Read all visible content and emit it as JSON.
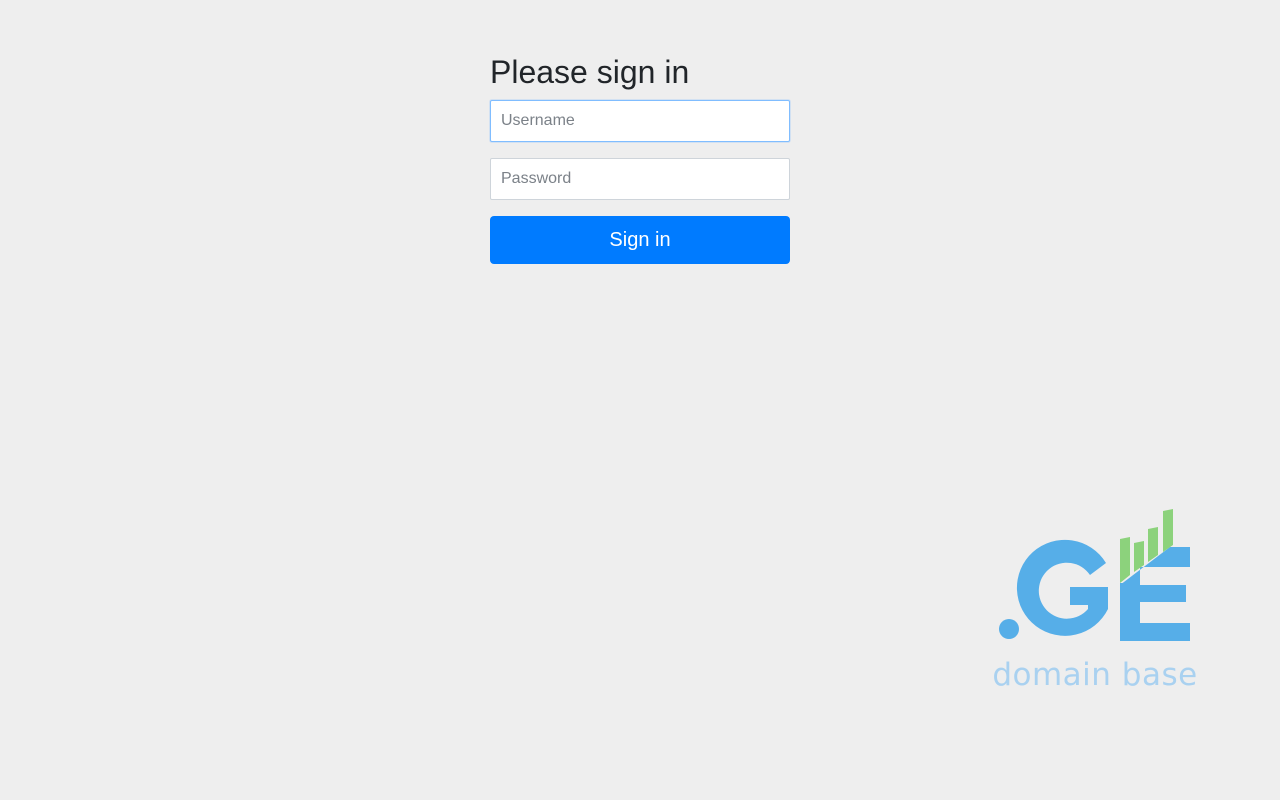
{
  "signin": {
    "heading": "Please sign in",
    "username_placeholder": "Username",
    "username_value": "",
    "password_placeholder": "Password",
    "password_value": "",
    "submit_label": "Sign in"
  },
  "logo": {
    "mark": ".GE",
    "caption": "domain base",
    "colors": {
      "blue": "#56aee8",
      "green": "#8cd27c",
      "caption": "#a9d1f0"
    }
  },
  "colors": {
    "background": "#eeeeee",
    "accent": "#007bff"
  }
}
